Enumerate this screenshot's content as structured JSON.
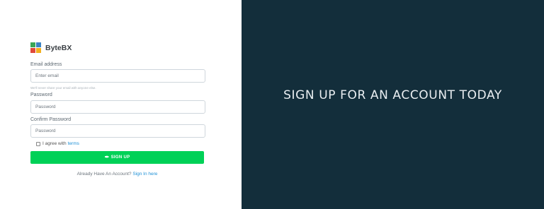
{
  "brand": {
    "name": "ByteBX",
    "logo_colors": [
      "#3aa657",
      "#3b83c4",
      "#e0493a",
      "#f2b01e"
    ]
  },
  "form": {
    "email_label": "Email address",
    "email_placeholder": "Enter email",
    "email_help": "We'll never share your email with anyone else.",
    "password_label": "Password",
    "password_placeholder": "Password",
    "confirm_label": "Confirm Password",
    "confirm_placeholder": "Password",
    "agree_text": "I agree with",
    "terms_link": "terms",
    "submit_label": "SIGN UP",
    "submit_icon": "feather-icon"
  },
  "footer": {
    "prompt": "Already Have An Account?",
    "link": "Sign In here"
  },
  "hero": {
    "title": "SIGN UP FOR AN ACCOUNT TODAY"
  },
  "colors": {
    "hero_background": "#132e3b",
    "button": "#00d157",
    "link": "#1e90d6"
  }
}
